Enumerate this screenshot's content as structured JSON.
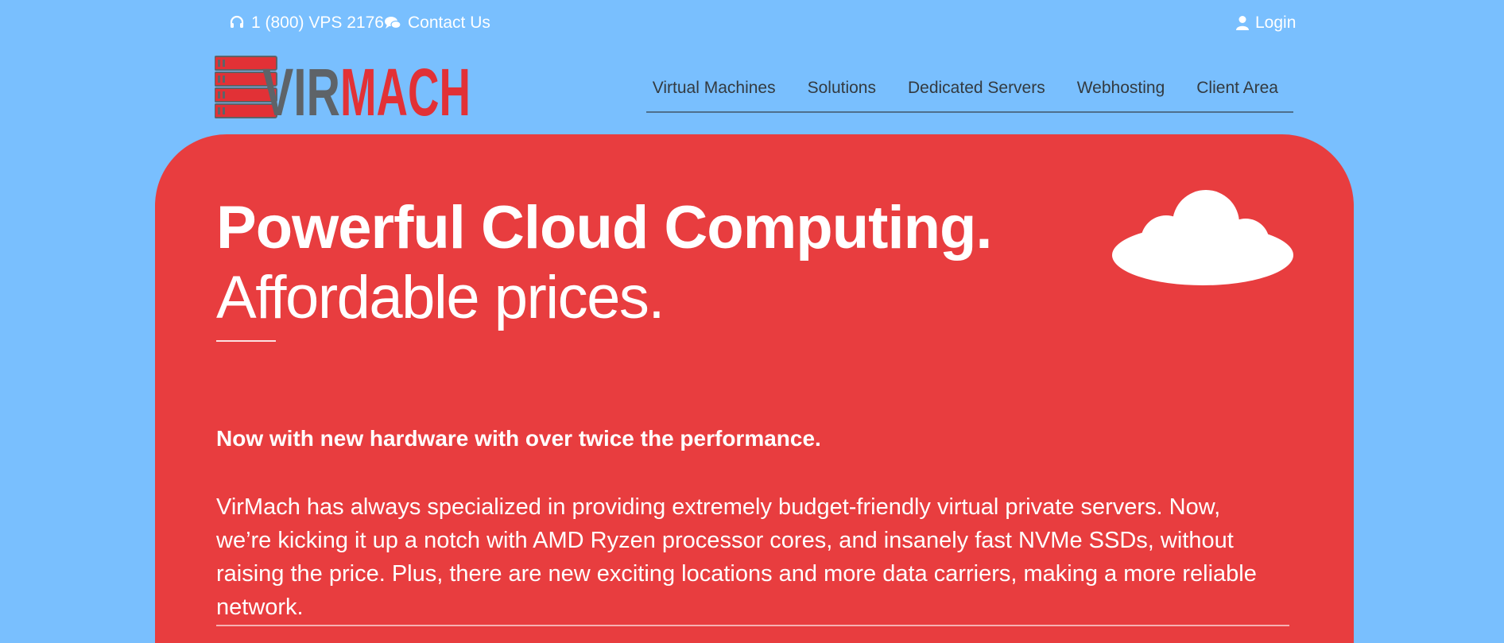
{
  "topbar": {
    "phone": "1 (800) VPS 2176",
    "contact": "Contact Us",
    "login": "Login"
  },
  "brand": {
    "logo_text_left": "VIR",
    "logo_text_right": "MACH",
    "colors": {
      "red": "#e23136",
      "gray": "#5e6368"
    }
  },
  "nav": {
    "items": [
      "Virtual Machines",
      "Solutions",
      "Dedicated Servers",
      "Webhosting",
      "Client Area"
    ]
  },
  "hero": {
    "headline": "Powerful Cloud Computing.",
    "subheadline": "Affordable prices.",
    "tagline": "Now with new hardware with over twice the performance.",
    "description": "VirMach has always specialized in providing extremely budget-friendly virtual private servers. Now, we’re kicking it up a notch with AMD Ryzen processor cores, and insanely fast NVMe SSDs, without raising the price. Plus, there are new exciting locations and more data carriers, making a more reliable network."
  },
  "colors": {
    "page_background": "#79bffe",
    "hero_background": "#e83d3f",
    "text_light": "#ffffff",
    "nav_text": "#333a40"
  },
  "icons": {
    "phone": "headset-icon",
    "contact": "chat-bubbles-icon",
    "login": "user-icon",
    "hero": "cloud-icon"
  }
}
